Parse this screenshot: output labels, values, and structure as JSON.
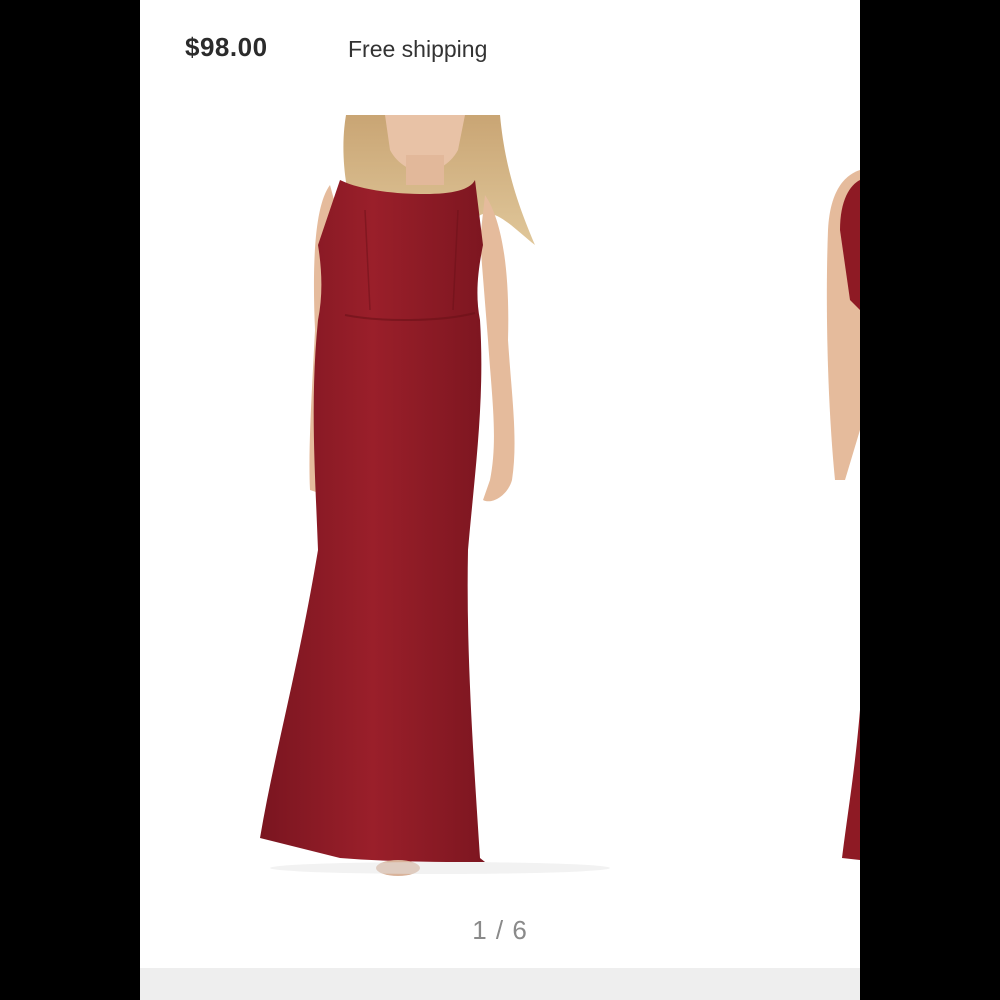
{
  "listing": {
    "price": "$98.00",
    "shipping": "Free shipping"
  },
  "gallery": {
    "counter": "1 / 6",
    "current_index": 1,
    "total_images": 6,
    "images": [
      {
        "subject": "model wearing long sleeveless burgundy gown, front view"
      },
      {
        "subject": "model wearing burgundy gown, back view (partially visible)"
      }
    ]
  },
  "colors": {
    "dress": "#8e1a24",
    "background": "#ffffff",
    "frame": "#000000"
  }
}
